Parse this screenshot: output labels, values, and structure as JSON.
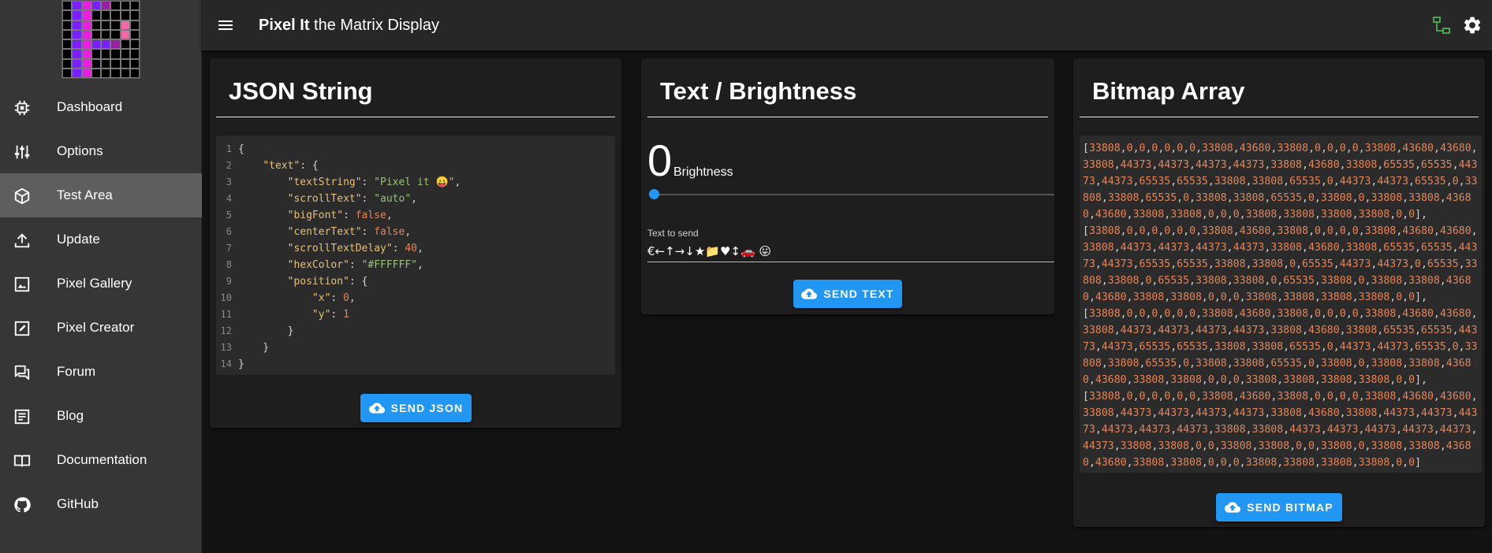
{
  "app": {
    "title_bold": "Pixel It",
    "title_rest": " the Matrix Display"
  },
  "logo_pixels": [
    [
      "#000",
      "#7a1fff",
      "#e91ee0",
      "#7a1fff",
      "#9b1fa0",
      "#000",
      "#000",
      "#000"
    ],
    [
      "#000",
      "#7a1fff",
      "#e91ee0",
      "#000",
      "#000",
      "#000",
      "#000",
      "#000"
    ],
    [
      "#000",
      "#7a1fff",
      "#e91ee0",
      "#000",
      "#000",
      "#000",
      "#f06aa8",
      "#000"
    ],
    [
      "#000",
      "#7a1fff",
      "#e91ee0",
      "#000",
      "#000",
      "#000",
      "#f06aa8",
      "#000"
    ],
    [
      "#000",
      "#7a1fff",
      "#e91ee0",
      "#7a1fff",
      "#7a1fff",
      "#9b1fa0",
      "#000",
      "#000"
    ],
    [
      "#000",
      "#7a1fff",
      "#e91ee0",
      "#000",
      "#000",
      "#000",
      "#000",
      "#000"
    ],
    [
      "#000",
      "#7a1fff",
      "#e91ee0",
      "#000",
      "#000",
      "#000",
      "#000",
      "#000"
    ],
    [
      "#000",
      "#7a1fff",
      "#e91ee0",
      "#000",
      "#000",
      "#000",
      "#000",
      "#000"
    ]
  ],
  "sidebar": {
    "items": [
      {
        "label": "Dashboard",
        "icon": "chip-icon"
      },
      {
        "label": "Options",
        "icon": "tune-icon"
      },
      {
        "label": "Test Area",
        "icon": "cube-icon",
        "active": true
      },
      {
        "label": "Update",
        "icon": "upload-icon"
      },
      {
        "label": "Pixel Gallery",
        "icon": "image-icon"
      },
      {
        "label": "Pixel Creator",
        "icon": "edit-icon"
      },
      {
        "label": "Forum",
        "icon": "forum-icon"
      },
      {
        "label": "Blog",
        "icon": "blog-icon"
      },
      {
        "label": "Documentation",
        "icon": "book-icon"
      },
      {
        "label": "GitHub",
        "icon": "github-icon"
      }
    ]
  },
  "json_card": {
    "title": "JSON String",
    "button": "SEND JSON",
    "lines": [
      {
        "n": "1",
        "html": "{"
      },
      {
        "n": "2",
        "html": "    <span class='k'>\"text\"</span>: {"
      },
      {
        "n": "3",
        "html": "        <span class='k'>\"textString\"</span>: <span class='s'>\"Pixel it 😛\"</span>,"
      },
      {
        "n": "4",
        "html": "        <span class='k'>\"scrollText\"</span>: <span class='s'>\"auto\"</span>,"
      },
      {
        "n": "5",
        "html": "        <span class='k'>\"bigFont\"</span>: <span class='b'>false</span>,"
      },
      {
        "n": "6",
        "html": "        <span class='k'>\"centerText\"</span>: <span class='b'>false</span>,"
      },
      {
        "n": "7",
        "html": "        <span class='k'>\"scrollTextDelay\"</span>: <span class='n'>40</span>,"
      },
      {
        "n": "8",
        "html": "        <span class='k'>\"hexColor\"</span>: <span class='s'>\"#FFFFFF\"</span>,"
      },
      {
        "n": "9",
        "html": "        <span class='k'>\"position\"</span>: {"
      },
      {
        "n": "10",
        "html": "            <span class='k'>\"x\"</span>: <span class='n'>0</span>,"
      },
      {
        "n": "11",
        "html": "            <span class='k'>\"y\"</span>: <span class='n'>1</span>"
      },
      {
        "n": "12",
        "html": "        }"
      },
      {
        "n": "13",
        "html": "    }"
      },
      {
        "n": "14",
        "html": "}"
      }
    ]
  },
  "text_card": {
    "title": "Text / Brightness",
    "brightness_value": "0",
    "brightness_label": "Brightness",
    "brightness_level": 0,
    "text_label": "Text to send",
    "text_value": "€←↑→↓★📁♥↕🚗 😛",
    "button": "SEND TEXT"
  },
  "bitmap_card": {
    "title": "Bitmap Array",
    "button": "SEND BITMAP",
    "content": "[33808,0,0,0,0,0,0,33808,43680,33808,0,0,0,0,33808,43680,43680,33808,44373,44373,44373,44373,33808,43680,33808,65535,65535,44373,44373,65535,65535,33808,33808,65535,0,44373,44373,65535,0,33808,33808,65535,0,33808,33808,65535,0,33808,0,33808,33808,43680,43680,33808,33808,0,0,0,33808,33808,33808,33808,0,0],\n[33808,0,0,0,0,0,0,33808,43680,33808,0,0,0,0,33808,43680,43680,33808,44373,44373,44373,44373,33808,43680,33808,65535,65535,44373,44373,65535,65535,33808,33808,0,65535,44373,44373,0,65535,33808,33808,0,65535,33808,33808,0,65535,33808,0,33808,33808,43680,43680,33808,33808,0,0,0,33808,33808,33808,33808,0,0],\n[33808,0,0,0,0,0,0,33808,43680,33808,0,0,0,0,33808,43680,43680,33808,44373,44373,44373,44373,33808,43680,33808,65535,65535,44373,44373,65535,65535,33808,33808,65535,0,44373,44373,65535,0,33808,33808,65535,0,33808,33808,65535,0,33808,0,33808,33808,43680,43680,33808,33808,0,0,0,33808,33808,33808,33808,0,0],\n[33808,0,0,0,0,0,0,33808,43680,33808,0,0,0,0,33808,43680,43680,33808,44373,44373,44373,44373,33808,43680,33808,44373,44373,44373,44373,44373,44373,33808,33808,44373,44373,44373,44373,44373,44373,33808,33808,0,0,33808,33808,0,0,33808,0,33808,33808,43680,43680,33808,33808,0,0,0,33808,33808,33808,33808,0,0]"
  }
}
